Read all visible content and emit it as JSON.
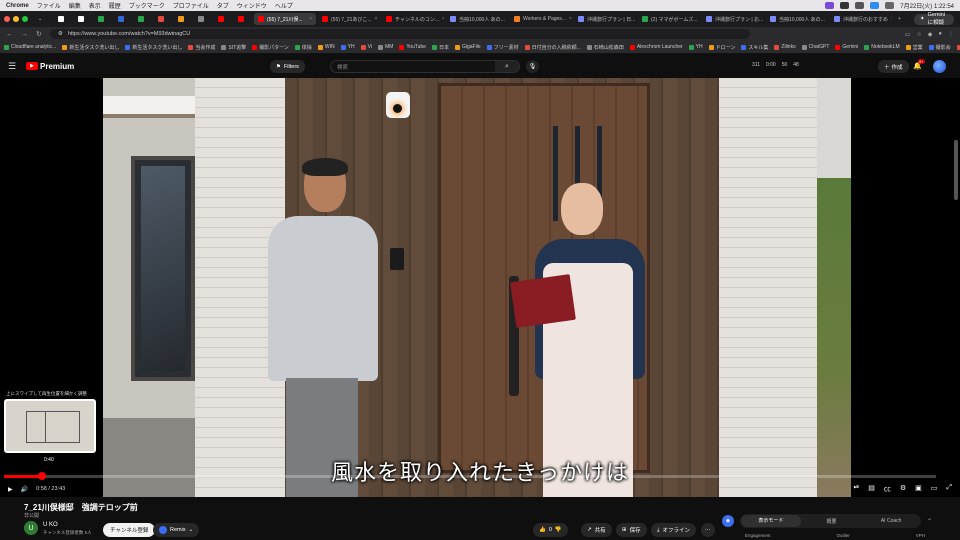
{
  "macos": {
    "app": "Chrome",
    "menus": [
      "ファイル",
      "編集",
      "表示",
      "履歴",
      "ブックマーク",
      "プロファイル",
      "タブ",
      "ウィンドウ",
      "ヘルプ"
    ],
    "clock": "7月22日(火) 1:22:54"
  },
  "tabs": [
    {
      "label": "",
      "color": "#ffffff"
    },
    {
      "label": "",
      "color": "#ffffff"
    },
    {
      "label": "",
      "color": "#2da44e"
    },
    {
      "label": "",
      "color": "#2f6bd8"
    },
    {
      "label": "",
      "color": "#2da44e"
    },
    {
      "label": "",
      "color": "#e34b3d"
    },
    {
      "label": "",
      "color": "#f09a1a"
    },
    {
      "label": "",
      "color": "#888888"
    },
    {
      "label": "",
      "color": "#ff0000"
    },
    {
      "label": "",
      "color": "#ff0000"
    },
    {
      "label": "(55) 7_21川俣...",
      "color": "#ff0000",
      "active": true
    },
    {
      "label": "(55) 7_21あびこ...",
      "color": "#ff0000"
    },
    {
      "label": "チャンネルのコン...",
      "color": "#ff0000"
    },
    {
      "label": "当冊10,000人 あの...",
      "color": "#7b8cff"
    },
    {
      "label": "Workers & Pages...",
      "color": "#f48120"
    },
    {
      "label": "沖縄旅行プラン | 日...",
      "color": "#7b8cff"
    },
    {
      "label": "(2) ママがボームズ...",
      "color": "#2da44e"
    },
    {
      "label": "沖縄旅行プラン | お...",
      "color": "#7b8cff"
    },
    {
      "label": "当冊10,000人 あの...",
      "color": "#7b8cff"
    },
    {
      "label": "沖縄旅行のおすすめ",
      "color": "#7b8cff"
    }
  ],
  "gemini_label": "Gemini に相談",
  "address": {
    "url": "https://www.youtube.com/watch?v=M93dwtnagCU"
  },
  "bookmarks": [
    "Cloudflare analytic...",
    "新生活タスク洗い出し",
    "新生活タスク洗い出し",
    "当会作成",
    "SIT追撃",
    "撮影パターン",
    "体操",
    "WIN",
    "YH",
    "Vi",
    "MM",
    "YouTube",
    "日本",
    "GigaFile",
    "フリー素材",
    "日付自分の入稿依頼...",
    "石崎山松森田",
    "Alexchrom Launcher",
    "YH",
    "ドローン",
    "スキル集",
    "Zilinks",
    "ChatGPT",
    "Gemini",
    "NotebookLM",
    "営業",
    "撮影会",
    "便利サイト"
  ],
  "youtube": {
    "logo": "Premium",
    "filters": "Filters",
    "search_placeholder": "検索",
    "stats": [
      "311",
      "0:00",
      "50",
      "48"
    ],
    "create": "作成",
    "notif_count": "9+"
  },
  "player": {
    "subtitle": "風水を取り入れたきっかけは",
    "preview_hint": "上にスワイプして再生位置を細かく調整",
    "preview_time": "0:40",
    "current_time": "0:58",
    "duration": "23:43",
    "progress": 0.041
  },
  "video": {
    "title": "7_21川俣様邸　強調テロップ前",
    "visibility": "非公開",
    "channel_initial": "U",
    "channel_name": "U KO",
    "subscribers": "チャンネル登録者数 5人",
    "subscribe_label": "チャンネル登録",
    "remix_label": "Remix",
    "likes": "0",
    "share_label": "共有",
    "save_label": "保存",
    "offline_label": "オフライン"
  },
  "side_panel": {
    "modes": [
      "表示モード",
      "概要",
      "AI Coach"
    ],
    "stats": [
      "Engagement",
      "Outlier",
      "VPH"
    ]
  }
}
